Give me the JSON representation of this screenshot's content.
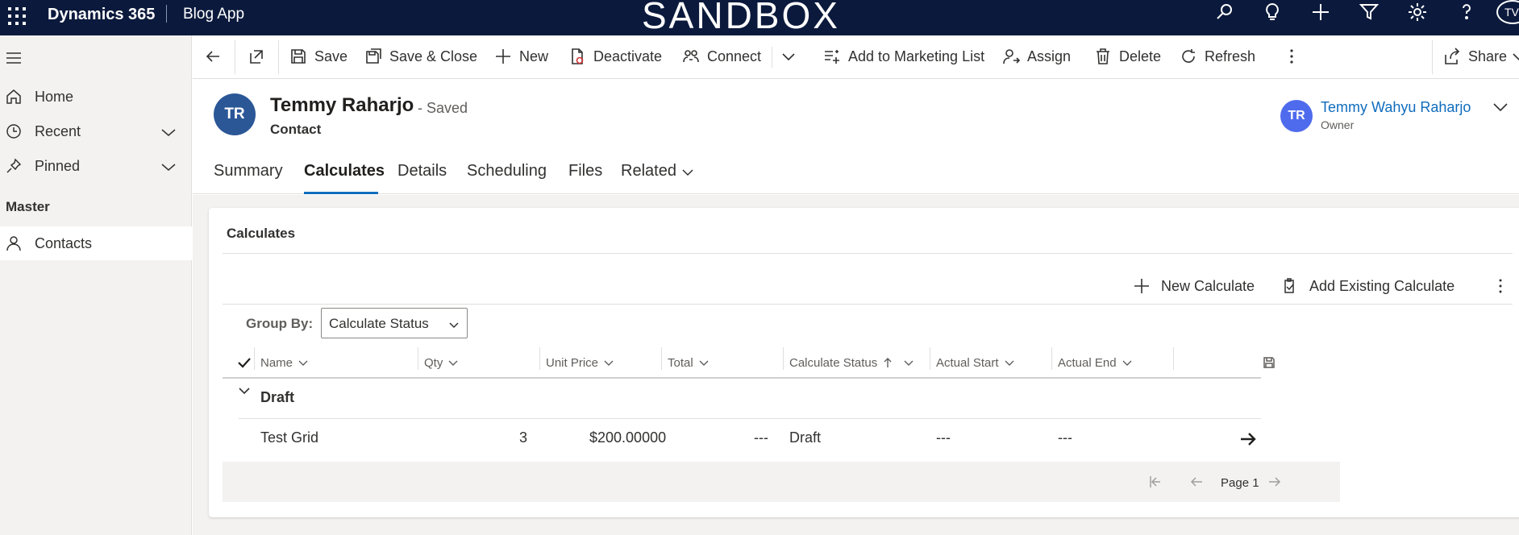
{
  "topbar": {
    "brand": "Dynamics 365",
    "app_name": "Blog App",
    "environment": "SANDBOX",
    "user_initials": "TV",
    "icons": [
      "search-icon",
      "lightbulb-icon",
      "plus-icon",
      "filter-icon",
      "settings-icon",
      "help-icon"
    ]
  },
  "sidebar": {
    "items": [
      {
        "label": "Home",
        "icon": "home-icon"
      },
      {
        "label": "Recent",
        "icon": "clock-icon"
      },
      {
        "label": "Pinned",
        "icon": "pin-icon"
      }
    ],
    "section_title": "Master",
    "entities": [
      {
        "label": "Contacts",
        "icon": "person-icon"
      }
    ]
  },
  "commands": {
    "save": "Save",
    "save_close": "Save & Close",
    "new": "New",
    "deactivate": "Deactivate",
    "connect": "Connect",
    "add_marketing": "Add to Marketing List",
    "assign": "Assign",
    "delete": "Delete",
    "refresh": "Refresh",
    "share": "Share"
  },
  "record": {
    "initials": "TR",
    "name": "Temmy Raharjo",
    "saved_status": "- Saved",
    "entity_type": "Contact",
    "owner_initials": "TR",
    "owner_name": "Temmy Wahyu Raharjo",
    "owner_label": "Owner"
  },
  "tabs": [
    {
      "label": "Summary"
    },
    {
      "label": "Calculates",
      "selected": true
    },
    {
      "label": "Details"
    },
    {
      "label": "Scheduling"
    },
    {
      "label": "Files"
    },
    {
      "label": "Related"
    }
  ],
  "subgrid": {
    "title": "Calculates",
    "new_label": "New Calculate",
    "add_existing_label": "Add Existing Calculate",
    "group_by_label": "Group By:",
    "group_by_value": "Calculate Status",
    "columns": [
      "Name",
      "Qty",
      "Unit Price",
      "Total",
      "Calculate Status",
      "Actual Start",
      "Actual End"
    ],
    "group_name": "Draft",
    "rows": [
      {
        "name": "Test Grid",
        "qty": "3",
        "unit_price": "$200.00000",
        "total": "---",
        "status": "Draft",
        "actual_start": "---",
        "actual_end": "---"
      }
    ],
    "page_label": "Page 1"
  },
  "colors": {
    "topbar_bg": "#0b1a3c",
    "accent": "#0f6cbd",
    "avatar_record": "#2b5797",
    "avatar_owner": "#4f6bed"
  }
}
